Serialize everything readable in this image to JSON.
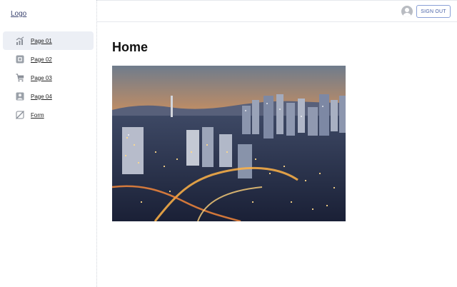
{
  "sidebar": {
    "logo": "Logo",
    "items": [
      {
        "label": "Page 01",
        "icon": "trending-up-icon",
        "active": true
      },
      {
        "label": "Page 02",
        "icon": "layers-icon",
        "active": false
      },
      {
        "label": "Page 03",
        "icon": "cart-icon",
        "active": false
      },
      {
        "label": "Page 04",
        "icon": "person-icon",
        "active": false
      },
      {
        "label": "Form",
        "icon": "slash-icon",
        "active": false
      }
    ]
  },
  "header": {
    "signout_label": "SIGN OUT",
    "avatar_icon": "account-circle-icon"
  },
  "main": {
    "title": "Home",
    "image": "city-skyline-night-photo"
  },
  "colors": {
    "accent": "#4a63a8",
    "active_bg": "#eceff5"
  }
}
